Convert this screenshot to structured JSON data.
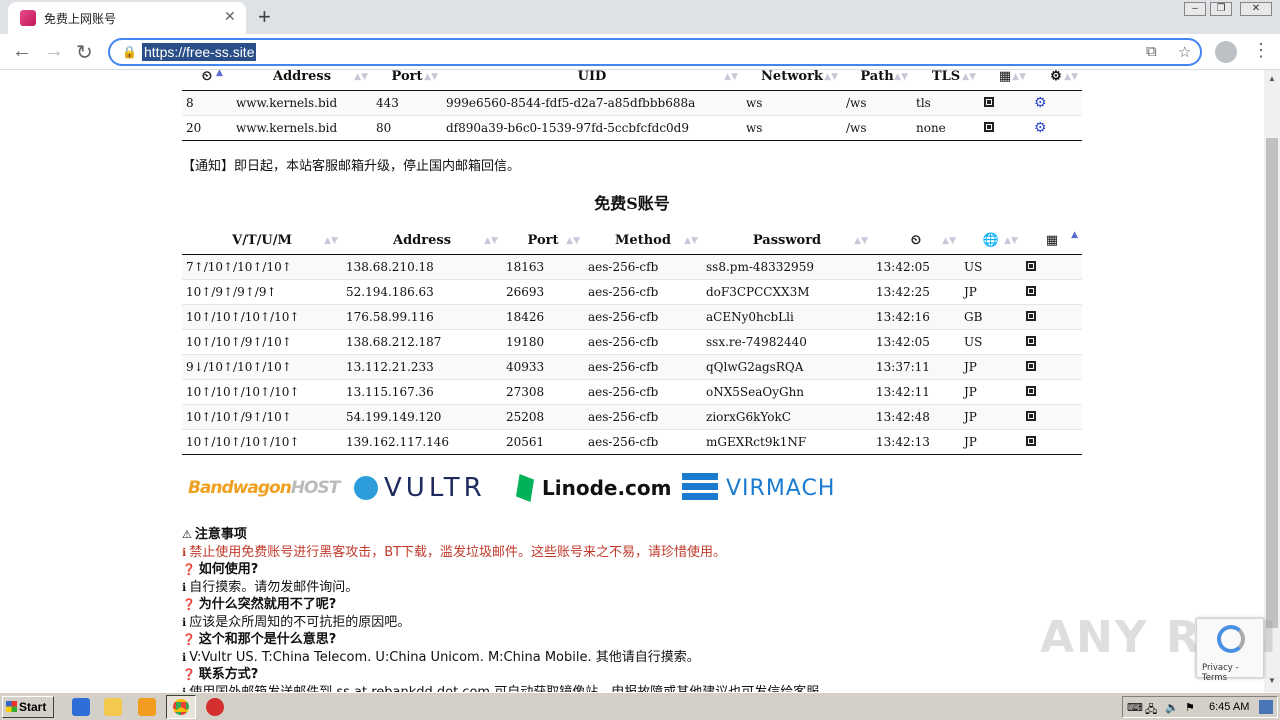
{
  "browser": {
    "tab_title": "免费上网账号",
    "url": "https://free-ss.site"
  },
  "v2ray_table": {
    "headers": [
      "⏲",
      "Address",
      "Port",
      "UID",
      "Network",
      "Path",
      "TLS",
      "▦",
      "⚙"
    ],
    "rows": [
      [
        "8",
        "www.kernels.bid",
        "443",
        "999e6560-8544-fdf5-d2a7-a85dfbbb688a",
        "ws",
        "/ws",
        "tls"
      ],
      [
        "20",
        "www.kernels.bid",
        "80",
        "df890a39-b6c0-1539-97fd-5ccbfcfdc0d9",
        "ws",
        "/ws",
        "none"
      ]
    ]
  },
  "notice": "【通知】即日起，本站客服邮箱升级，停止国内邮箱回信。",
  "ss_section_title": "免费S账号",
  "ss_table": {
    "headers": [
      "V/T/U/M",
      "Address",
      "Port",
      "Method",
      "Password",
      "⏲",
      "🌐",
      "▦"
    ],
    "rows": [
      [
        "7↑/10↑/10↑/10↑",
        "138.68.210.18",
        "18163",
        "aes-256-cfb",
        "ss8.pm-48332959",
        "13:42:05",
        "US"
      ],
      [
        "10↑/9↑/9↑/9↑",
        "52.194.186.63",
        "26693",
        "aes-256-cfb",
        "doF3CPCCXX3M",
        "13:42:25",
        "JP"
      ],
      [
        "10↑/10↑/10↑/10↑",
        "176.58.99.116",
        "18426",
        "aes-256-cfb",
        "aCENy0hcbLli",
        "13:42:16",
        "GB"
      ],
      [
        "10↑/10↑/9↑/10↑",
        "138.68.212.187",
        "19180",
        "aes-256-cfb",
        "ssx.re-74982440",
        "13:42:05",
        "US"
      ],
      [
        "9↓/10↑/10↑/10↑",
        "13.112.21.233",
        "40933",
        "aes-256-cfb",
        "qQlwG2agsRQA",
        "13:37:11",
        "JP"
      ],
      [
        "10↑/10↑/10↑/10↑",
        "13.115.167.36",
        "27308",
        "aes-256-cfb",
        "oNX5SeaOyGhn",
        "13:42:11",
        "JP"
      ],
      [
        "10↑/10↑/9↑/10↑",
        "54.199.149.120",
        "25208",
        "aes-256-cfb",
        "ziorxG6kYokC",
        "13:42:48",
        "JP"
      ],
      [
        "10↑/10↑/10↑/10↑",
        "139.162.117.146",
        "20561",
        "aes-256-cfb",
        "mGEXRct9k1NF",
        "13:42:13",
        "JP"
      ]
    ]
  },
  "logos": {
    "bandwagon_a": "Bandwagon",
    "bandwagon_b": "HOST",
    "vultr": "VULTR",
    "linode": "Linode.com",
    "virmach": "VIRMACH"
  },
  "faq": [
    {
      "q": "注意事项",
      "a": "禁止使用免费账号进行黑客攻击，BT下载，滥发垃圾邮件。这些账号来之不易，请珍惜使用。",
      "warn": true
    },
    {
      "q": "如何使用?",
      "a": "自行摸索。请勿发邮件询问。"
    },
    {
      "q": "为什么突然就用不了呢?",
      "a": "应该是众所周知的不可抗拒的原因吧。"
    },
    {
      "q": "这个和那个是什么意思?",
      "a": "V:Vultr US. T:China Telecom. U:China Unicom. M:China Mobile. 其他请自行摸索。"
    },
    {
      "q": "联系方式?",
      "a": "使用国外邮箱发送邮件到 ss at rebankdd dot com 可自动获取镜像站，申报故障或其他建议也可发信给客服。"
    }
  ],
  "recaptcha": {
    "text": "Privacy - Terms"
  },
  "watermark": "ANY RUN",
  "taskbar": {
    "start": "Start",
    "clock": "6:45 AM"
  }
}
